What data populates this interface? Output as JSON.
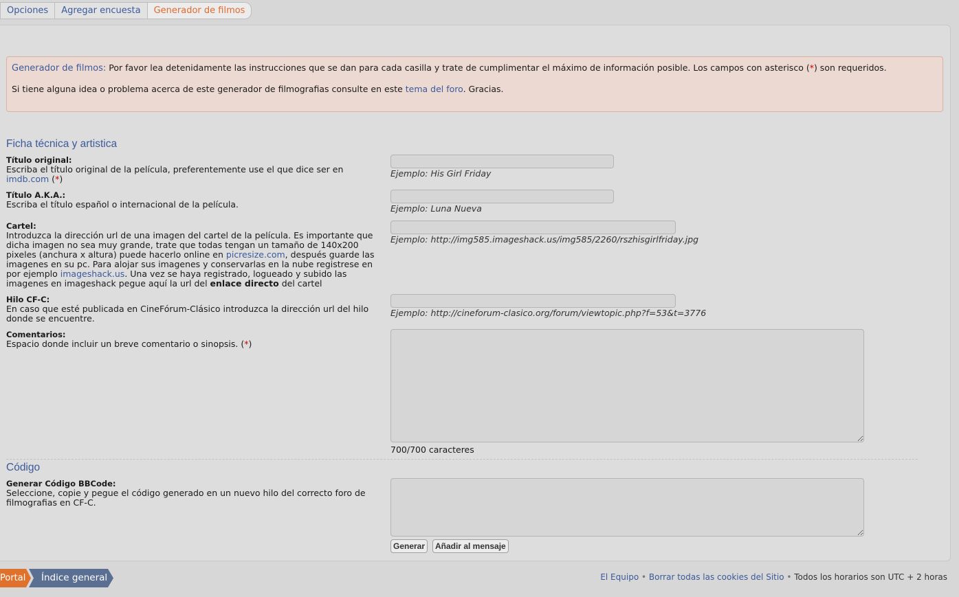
{
  "tabs": [
    {
      "label": "Opciones"
    },
    {
      "label": "Agregar encuesta"
    },
    {
      "label": "Generador de filmos"
    }
  ],
  "notice": {
    "title": "Generador de filmos:",
    "text1": " Por favor lea detenidamente las instrucciones que se dan para cada casilla y trate de cumplimentar el máximo de información posible. Los campos con asterisco (",
    "asterisk": "*",
    "text1_end": ") son requeridos.",
    "text2": "Si tiene alguna idea o problema acerca de este generador de filmografias consulte en este ",
    "link": "tema del foro",
    "text2_end": ". Gracias."
  },
  "section1": {
    "title": "Ficha técnica y artistica"
  },
  "fields": {
    "titulo_original": {
      "label": "Título original:",
      "desc": "Escriba el título original de la película, preferentemente use el que dice ser en ",
      "link": "imdb.com",
      "req_open": " (",
      "req": "*",
      "req_close": ")",
      "example": "Ejemplo: His Girl Friday"
    },
    "titulo_aka": {
      "label": "Título A.K.A.:",
      "desc": "Escriba el título español o internacional de la película.",
      "example": "Ejemplo: Luna Nueva"
    },
    "cartel": {
      "label": "Cartel:",
      "desc1": "Introduzca la dirección url de una imagen del cartel de la película. Es importante que dicha imagen no sea muy grande, trate que todas tengan un tamaño de 140x200 pixeles (anchura x altura) puede hacerlo online en ",
      "link1": "picresize.com",
      "desc2": ", después guarde las imagenes en su pc. Para alojar sus imagenes y conservarlas en la nube registrese en por ejemplo ",
      "link2": "imageshack.us",
      "desc3": ". Una vez se haya registrado, logueado y subido las imagenes en imageshack pegue aquí la url del ",
      "bold": "enlace directo",
      "desc4": " del cartel",
      "example": "Ejemplo: http://img585.imageshack.us/img585/2260/rszhisgirlfriday.jpg"
    },
    "hilo": {
      "label": "Hilo CF-C:",
      "desc": "En caso que esté publicada en CineFórum-Clásico introduzca la dirección url del hilo donde se encuentre.",
      "example": "Ejemplo: http://cineforum-clasico.org/forum/viewtopic.php?f=53&t=3776"
    },
    "comentarios": {
      "label": "Comentarios:",
      "desc": "Espacio donde incluir un breve comentario o sinopsis. (",
      "req": "*",
      "req_close": ")",
      "counter": "700/700 caracteres"
    }
  },
  "section2": {
    "title": "Código"
  },
  "codigo": {
    "label": "Generar Código BBCode:",
    "desc": "Seleccione, copie y pegue el código generado en un nuevo hilo del correcto foro de filmografias en CF-C.",
    "btn_generar": "Generar",
    "btn_anadir": "Añadir al mensaje"
  },
  "breadcrumb": {
    "portal": "Portal",
    "index": "Índice general"
  },
  "footer": {
    "team": "El Equipo",
    "sep": " • ",
    "cookies": "Borrar todas las cookies del Sitio",
    "timezone": "Todos los horarios son UTC + 2 horas"
  }
}
